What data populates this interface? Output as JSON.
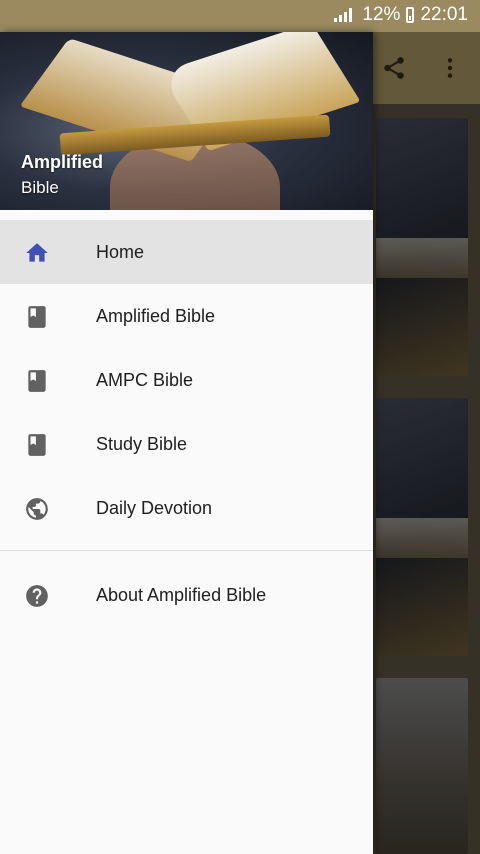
{
  "status_bar": {
    "battery_percent": "12%",
    "time": "22:01"
  },
  "drawer_header": {
    "title": "Amplified",
    "subtitle": "Bible"
  },
  "menu": {
    "items": [
      {
        "label": "Home",
        "icon": "home-icon",
        "active": true
      },
      {
        "label": "Amplified Bible",
        "icon": "book-icon",
        "active": false
      },
      {
        "label": "AMPC Bible",
        "icon": "book-icon",
        "active": false
      },
      {
        "label": "Study Bible",
        "icon": "book-icon",
        "active": false
      },
      {
        "label": "Daily Devotion",
        "icon": "globe-icon",
        "active": false
      }
    ],
    "secondary": [
      {
        "label": "About Amplified Bible",
        "icon": "help-icon"
      }
    ]
  },
  "toolbar_icons": [
    "share-icon",
    "more-vert-icon"
  ],
  "colors": {
    "status_bar": "#9b8a60",
    "toolbar": "#8a7a50",
    "active_icon": "#3f51b5",
    "inactive_icon": "#616161",
    "active_row": "#e3e3e3"
  }
}
